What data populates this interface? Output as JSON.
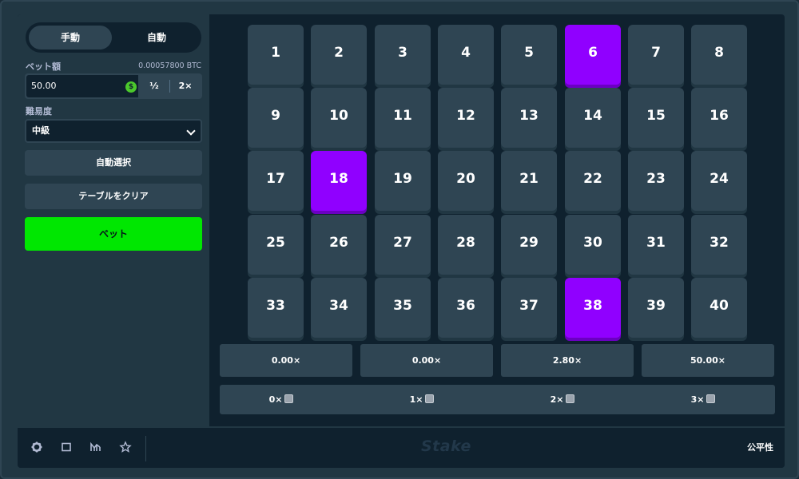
{
  "sidebar": {
    "mode_manual": "手動",
    "mode_auto": "自動",
    "bet_label": "ベット額",
    "bet_btc": "0.00057800 BTC",
    "bet_value": "50.00",
    "coin_symbol": "$",
    "half_label": "½",
    "double_label": "2×",
    "difficulty_label": "難易度",
    "difficulty_value": "中級",
    "auto_pick_label": "自動選択",
    "clear_table_label": "テーブルをクリア",
    "bet_button_label": "ベット"
  },
  "board": {
    "tiles": [
      "1",
      "2",
      "3",
      "4",
      "5",
      "6",
      "7",
      "8",
      "9",
      "10",
      "11",
      "12",
      "13",
      "14",
      "15",
      "16",
      "17",
      "18",
      "19",
      "20",
      "21",
      "22",
      "23",
      "24",
      "25",
      "26",
      "27",
      "28",
      "29",
      "30",
      "31",
      "32",
      "33",
      "34",
      "35",
      "36",
      "37",
      "38",
      "39",
      "40"
    ],
    "selected": [
      6,
      18,
      38
    ],
    "selected_color": "#9000ff"
  },
  "payouts": [
    "0.00×",
    "0.00×",
    "2.80×",
    "50.00×"
  ],
  "hits": [
    "0×",
    "1×",
    "2×",
    "3×"
  ],
  "footer": {
    "icons": [
      "gear-icon",
      "square-icon",
      "stats-icon",
      "star-icon"
    ],
    "logo": "Stake",
    "fairness_label": "公平性"
  },
  "colors": {
    "accent_green": "#00e701",
    "panel": "#213743",
    "tile": "#2f4553"
  }
}
